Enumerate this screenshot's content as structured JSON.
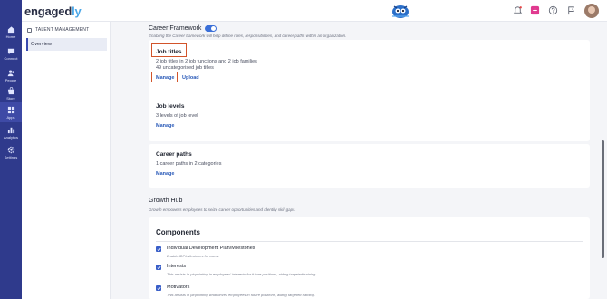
{
  "header": {
    "logo_main": "engaged",
    "logo_accent": "ly"
  },
  "rail": {
    "items": [
      {
        "label": "Home",
        "icon": "home-icon"
      },
      {
        "label": "Connect",
        "icon": "chat-icon"
      },
      {
        "label": "People",
        "icon": "people-icon"
      },
      {
        "label": "Store",
        "icon": "store-icon"
      },
      {
        "label": "Apps",
        "icon": "apps-icon"
      },
      {
        "label": "Analytics",
        "icon": "analytics-icon"
      },
      {
        "label": "Settings",
        "icon": "gear-icon"
      }
    ],
    "active_index": 4
  },
  "subnav": {
    "title": "TALENT MANAGEMENT",
    "items": [
      {
        "label": "Overview"
      }
    ]
  },
  "career_framework": {
    "title": "Career Framework",
    "enabled": true,
    "description": "Enabling the Career framework will help define roles, responsibilities, and career paths within an organization."
  },
  "cards": {
    "job_titles": {
      "title": "Job titles",
      "line1": "2 job titles in 2 job functions and 2 job families",
      "line2": "49 uncategorised job titles",
      "manage": "Manage",
      "upload": "Upload"
    },
    "job_levels": {
      "title": "Job levels",
      "line1": "3 levels of job level",
      "manage": "Manage"
    },
    "career_paths": {
      "title": "Career paths",
      "line1": "1 career paths in 2 categories",
      "manage": "Manage"
    }
  },
  "growth_hub": {
    "title": "Growth Hub",
    "description": "Growth empowers employees to seize career opportunities and identify skill gaps."
  },
  "components": {
    "title": "Components",
    "items": [
      {
        "name": "Individual Development Plan/Milestones",
        "desc": "Enable IDP/milestones for users.",
        "checked": true
      },
      {
        "name": "Interests",
        "desc": "This assists in pinpointing in employees' interests for future positions, aiding targeted training.",
        "checked": true
      },
      {
        "name": "Motivators",
        "desc": "This assists in pinpointing what drives employees in future positions, aiding targeted training.",
        "checked": true
      }
    ]
  },
  "colors": {
    "rail": "#2f3a8c",
    "accent": "#3a6fd8",
    "link": "#2a5ab8",
    "highlight": "#d2542a"
  }
}
